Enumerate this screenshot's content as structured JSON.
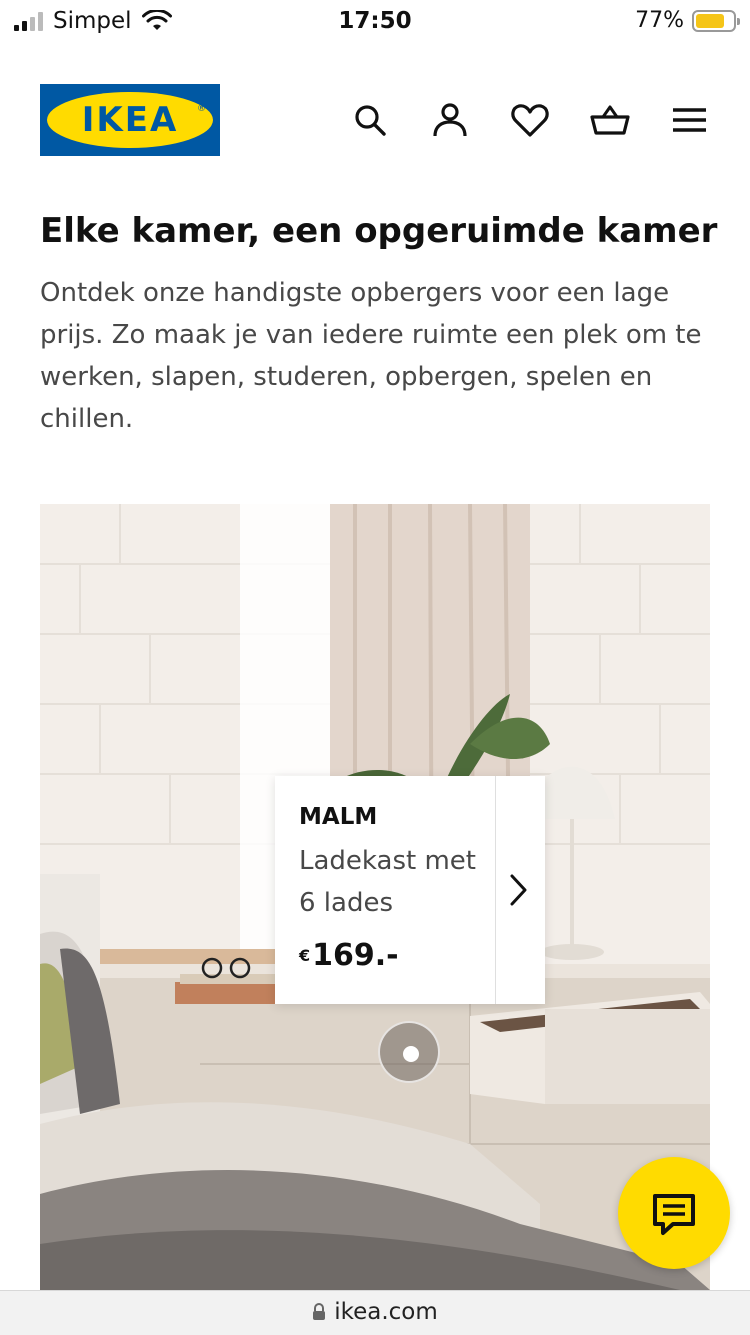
{
  "status_bar": {
    "carrier": "Simpel",
    "time": "17:50",
    "battery_percent": "77%",
    "battery_level": 0.77,
    "signal_bars": 2,
    "battery_color": "#f5c518"
  },
  "header": {
    "logo_text": "IKEA",
    "icons": [
      "search-icon",
      "account-icon",
      "heart-icon",
      "basket-icon",
      "menu-icon"
    ]
  },
  "main": {
    "headline": "Elke kamer, een opgeruimde kamer",
    "intro": "Ontdek onze handigste opbergers voor een lage prijs. Zo maak je van iedere ruimte een plek om te werken, slapen, studeren, opbergen, spelen en chillen."
  },
  "product_card": {
    "name": "MALM",
    "description": "Ladekast met 6 lades",
    "currency": "€",
    "price": "169.-"
  },
  "url_bar": {
    "domain": "ikea.com"
  },
  "colors": {
    "ikea_blue": "#0058a3",
    "ikea_yellow": "#ffdb00",
    "text_dark": "#111111",
    "text_gray": "#484848"
  }
}
